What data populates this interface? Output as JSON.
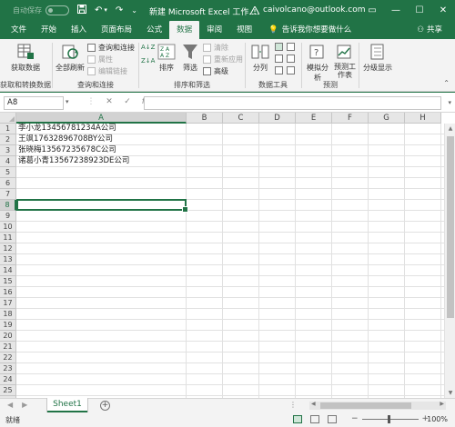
{
  "titlebar": {
    "autosave_label": "自动保存",
    "autosave_state": "关",
    "document_title": "新建 Microsoft Excel 工作...",
    "account": "caivolcano@outlook.com"
  },
  "tabs": [
    {
      "label": "文件",
      "active": false
    },
    {
      "label": "开始",
      "active": false
    },
    {
      "label": "插入",
      "active": false
    },
    {
      "label": "页面布局",
      "active": false
    },
    {
      "label": "公式",
      "active": false
    },
    {
      "label": "数据",
      "active": true
    },
    {
      "label": "审阅",
      "active": false
    },
    {
      "label": "视图",
      "active": false
    }
  ],
  "tellme": "告诉我你想要做什么",
  "share": "共享",
  "ribbon": {
    "get_data": {
      "label": "获取数据",
      "group": "获取和转换数据"
    },
    "refresh_all": {
      "label": "全部刷新",
      "group": "查询和连接"
    },
    "queries": {
      "connections": "查询和连接",
      "properties": "属性",
      "edit_links": "编辑链接"
    },
    "sort_filter": {
      "sort": "排序",
      "filter": "筛选",
      "clear": "清除",
      "reapply": "重新应用",
      "advanced": "高级",
      "group": "排序和筛选"
    },
    "data_tools": {
      "split": "分列",
      "group": "数据工具"
    },
    "forecast": {
      "whatif": "模拟分析",
      "forecast_sheet": "预测工作表",
      "group": "预测"
    },
    "outline": {
      "label": "分级显示"
    }
  },
  "formula_bar": {
    "name_box": "A8",
    "cancel": "✕",
    "enter": "✓",
    "fx": "fx",
    "formula": ""
  },
  "grid": {
    "columns": [
      "A",
      "B",
      "C",
      "D",
      "E",
      "F",
      "G",
      "H"
    ],
    "selected_column": "A",
    "selected_row": 8,
    "row_count": 26,
    "cells": [
      {
        "ref": "A1",
        "value": "李小龙13456781234A公司"
      },
      {
        "ref": "A2",
        "value": "王飒17632896708BY公司"
      },
      {
        "ref": "A3",
        "value": "张晓梅13567235678C公司"
      },
      {
        "ref": "A4",
        "value": "诸葛小青13567238923DE公司"
      }
    ]
  },
  "sheets": [
    {
      "name": "Sheet1",
      "active": true
    }
  ],
  "status": {
    "ready": "就绪",
    "zoom": "100%"
  },
  "colors": {
    "accent": "#217346",
    "grid_line": "#e1e1e1",
    "header_bg": "#e6e6e6"
  }
}
